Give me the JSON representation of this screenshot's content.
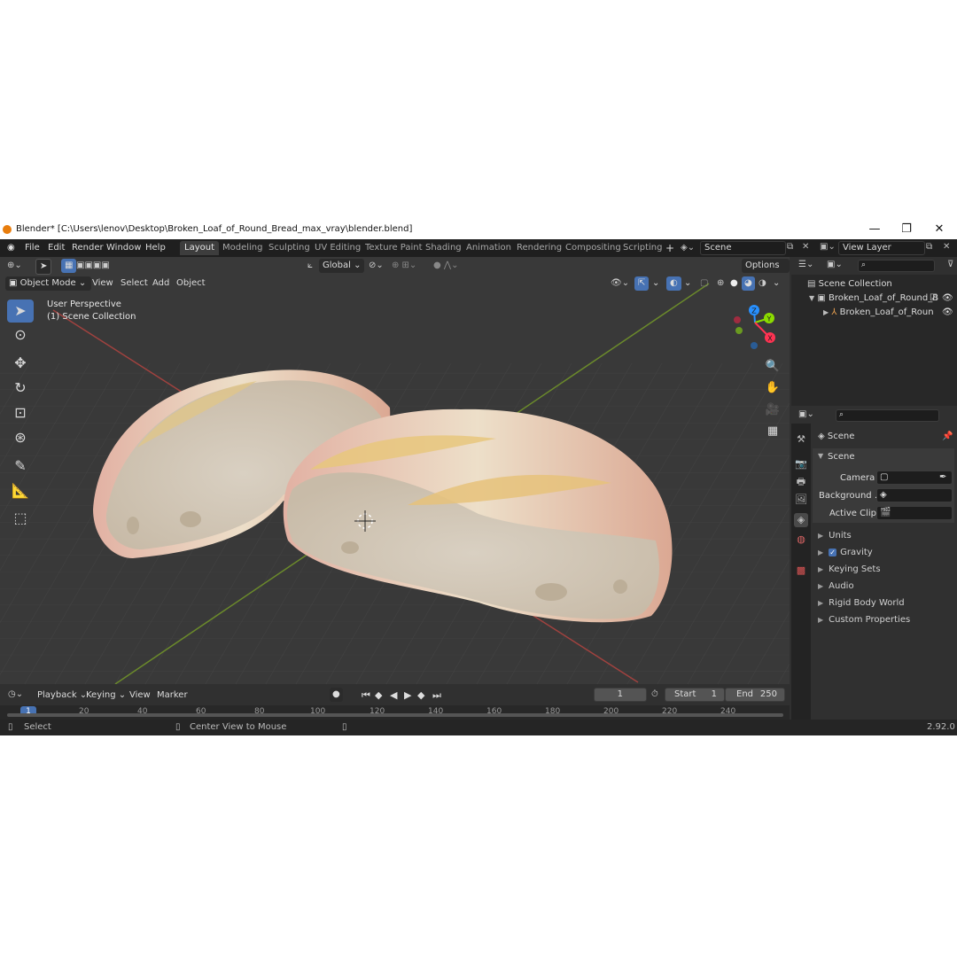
{
  "window": {
    "title": "Blender* [C:\\Users\\lenov\\Desktop\\Broken_Loaf_of_Round_Bread_max_vray\\blender.blend]",
    "minimize": "—",
    "maximize": "❐",
    "close": "✕"
  },
  "menu": [
    "File",
    "Edit",
    "Render",
    "Window",
    "Help"
  ],
  "workspaces": [
    "Layout",
    "Modeling",
    "Sculpting",
    "UV Editing",
    "Texture Paint",
    "Shading",
    "Animation",
    "Rendering",
    "Compositing",
    "Scripting"
  ],
  "active_workspace": "Layout",
  "scene_field": "Scene",
  "view_layer_field": "View Layer",
  "viewport": {
    "transform_orientation": "Global",
    "options_label": "Options",
    "mode": "Object Mode",
    "header_menus": [
      "View",
      "Select",
      "Add",
      "Object"
    ],
    "overlay_line1": "User Perspective",
    "overlay_line2": "(1) Scene Collection",
    "gizmo_axes": {
      "x": "X",
      "y": "Y",
      "z": "Z"
    }
  },
  "outliner": {
    "root": "Scene Collection",
    "item1": "Broken_Loaf_of_Round_B",
    "item2": "Broken_Loaf_of_Roun"
  },
  "properties": {
    "context": "Scene",
    "panel_title": "Scene",
    "camera_label": "Camera",
    "background_label": "Background ...",
    "active_clip_label": "Active Clip",
    "sections": [
      "Units",
      "Gravity",
      "Keying Sets",
      "Audio",
      "Rigid Body World",
      "Custom Properties"
    ],
    "gravity_checked": true
  },
  "timeline": {
    "menus": [
      "Playback",
      "Keying",
      "View",
      "Marker"
    ],
    "current_frame": "1",
    "start_label": "Start",
    "start_value": "1",
    "end_label": "End",
    "end_value": "250",
    "ruler_ticks": [
      "1",
      "20",
      "40",
      "60",
      "80",
      "100",
      "120",
      "140",
      "160",
      "180",
      "200",
      "220",
      "240"
    ]
  },
  "statusbar": {
    "select": "Select",
    "center_view": "Center View to Mouse",
    "version": "2.92.0"
  },
  "colors": {
    "accent": "#4772b3",
    "x_axis": "#ff3352",
    "y_axis": "#8bdc00",
    "z_axis": "#2890ff",
    "viewport_bg": "#393939"
  }
}
